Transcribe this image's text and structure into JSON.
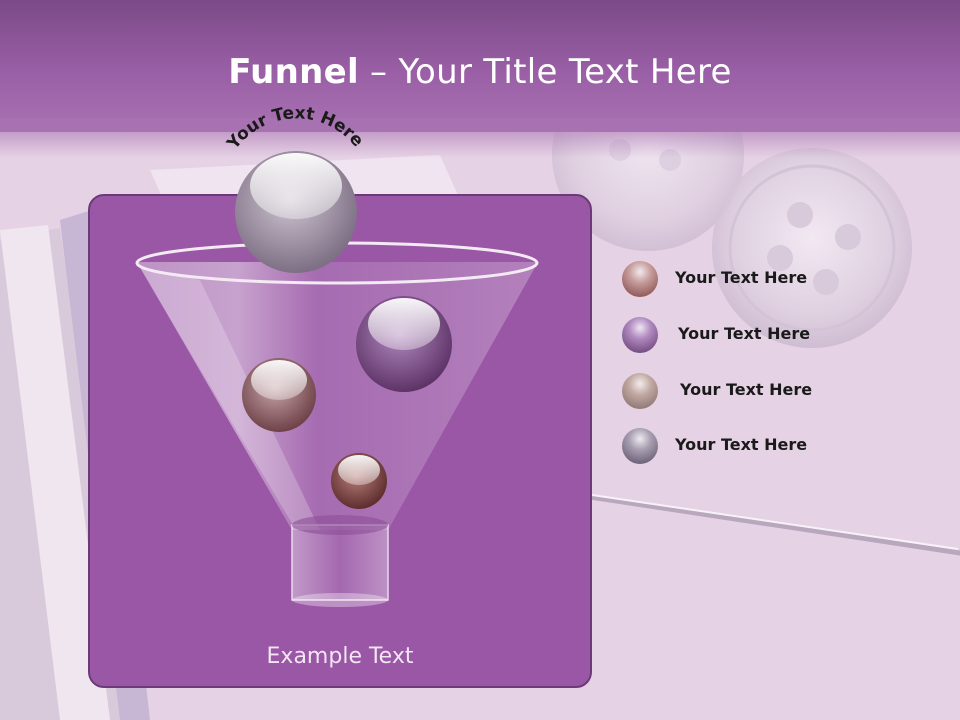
{
  "slide": {
    "title_bold": "Funnel",
    "title_rest": " – Your Title Text Here",
    "arc_text": "Your Text Here",
    "example_text": "Example Text"
  },
  "legend": [
    {
      "label": "Your  Text Here",
      "color": "#7a3f3f"
    },
    {
      "label": "Your  Text Here",
      "color": "#6a3a7c"
    },
    {
      "label": "Your  Text Here",
      "color": "#8a6a66"
    },
    {
      "label": "Your  Text Here",
      "color": "#5c4f66"
    }
  ],
  "colors": {
    "title_band": "#9a5fa6",
    "panel": "#9a57a6",
    "panel_border": "#6c3a78",
    "background": "#e8d3e6"
  }
}
